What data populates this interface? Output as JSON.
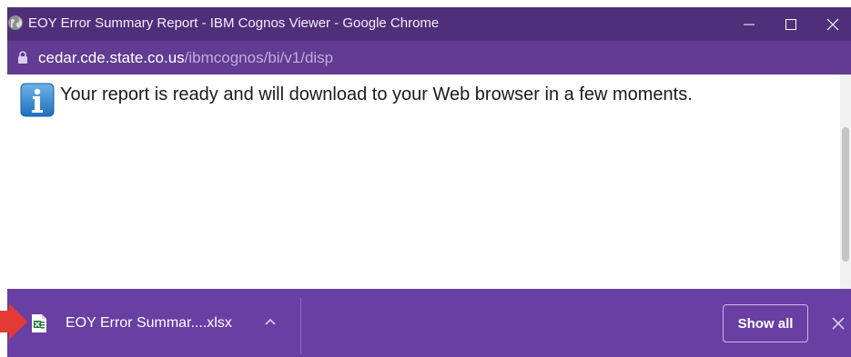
{
  "window": {
    "title": "EOY Error Summary Report - IBM Cognos Viewer - Google Chrome",
    "controls": {
      "minimize": "minimize-icon",
      "maximize": "maximize-icon",
      "close": "close-icon"
    }
  },
  "address": {
    "host": "cedar.cde.state.co.us",
    "path": "/ibmcognos/bi/v1/disp"
  },
  "content": {
    "message": "Your report is ready and will download to your Web browser in a few moments."
  },
  "download_bar": {
    "file_name": "EOY Error Summar....xlsx",
    "show_all_label": "Show all"
  },
  "colors": {
    "titlebar": "#4f2f79",
    "addressbar": "#623b92",
    "download_bar": "#6a3fa3",
    "annotation_arrow": "#e53935"
  },
  "icons": [
    "globe-icon",
    "lock-icon",
    "info-icon",
    "excel-file-icon",
    "chevron-up-icon",
    "close-icon",
    "pointer-arrow"
  ]
}
